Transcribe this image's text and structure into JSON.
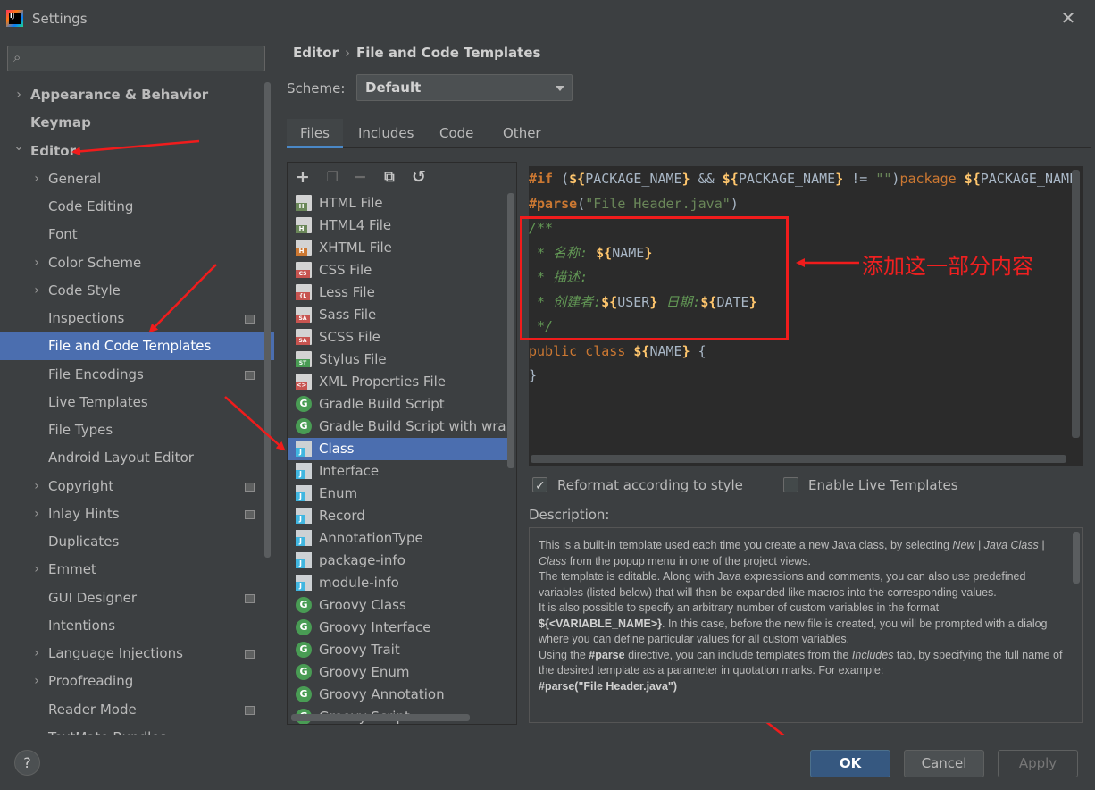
{
  "window": {
    "title": "Settings",
    "close_glyph": "✕"
  },
  "search": {
    "placeholder": ""
  },
  "sidebar": {
    "items": [
      {
        "label": "Appearance & Behavior",
        "expandable": true,
        "bold": true,
        "indent": 0
      },
      {
        "label": "Keymap",
        "expandable": false,
        "bold": true,
        "indent": 0
      },
      {
        "label": "Editor",
        "expandable": true,
        "expanded": true,
        "bold": true,
        "indent": 0
      },
      {
        "label": "General",
        "expandable": true,
        "indent": 1
      },
      {
        "label": "Code Editing",
        "indent": 1
      },
      {
        "label": "Font",
        "indent": 1
      },
      {
        "label": "Color Scheme",
        "expandable": true,
        "indent": 1
      },
      {
        "label": "Code Style",
        "expandable": true,
        "indent": 1
      },
      {
        "label": "Inspections",
        "indent": 1,
        "project_icon": true
      },
      {
        "label": "File and Code Templates",
        "indent": 1,
        "selected": true
      },
      {
        "label": "File Encodings",
        "indent": 1,
        "project_icon": true
      },
      {
        "label": "Live Templates",
        "indent": 1
      },
      {
        "label": "File Types",
        "indent": 1
      },
      {
        "label": "Android Layout Editor",
        "indent": 1
      },
      {
        "label": "Copyright",
        "expandable": true,
        "indent": 1,
        "project_icon": true
      },
      {
        "label": "Inlay Hints",
        "expandable": true,
        "indent": 1,
        "project_icon": true
      },
      {
        "label": "Duplicates",
        "indent": 1
      },
      {
        "label": "Emmet",
        "expandable": true,
        "indent": 1
      },
      {
        "label": "GUI Designer",
        "indent": 1,
        "project_icon": true
      },
      {
        "label": "Intentions",
        "indent": 1
      },
      {
        "label": "Language Injections",
        "expandable": true,
        "indent": 1,
        "project_icon": true
      },
      {
        "label": "Proofreading",
        "expandable": true,
        "indent": 1
      },
      {
        "label": "Reader Mode",
        "indent": 1,
        "project_icon": true
      },
      {
        "label": "TextMate Bundles",
        "indent": 1
      }
    ]
  },
  "breadcrumb": {
    "parent": "Editor",
    "separator": "›",
    "current": "File and Code Templates"
  },
  "scheme": {
    "label": "Scheme:",
    "value": "Default"
  },
  "tabs": [
    {
      "label": "Files",
      "active": true
    },
    {
      "label": "Includes"
    },
    {
      "label": "Code"
    },
    {
      "label": "Other"
    }
  ],
  "toolbar": {
    "add": "+",
    "copy_disabled": "❐",
    "remove": "−",
    "duplicate": "⧉",
    "reset": "↺"
  },
  "templates": [
    {
      "name": "HTML File",
      "icon": "html-file-icon",
      "tag": "H",
      "tag_color": "#6a8759"
    },
    {
      "name": "HTML4 File",
      "icon": "html-file-icon",
      "tag": "H",
      "tag_color": "#6a8759"
    },
    {
      "name": "XHTML File",
      "icon": "xhtml-file-icon",
      "tag": "H",
      "tag_color": "#cc7832"
    },
    {
      "name": "CSS File",
      "icon": "css-file-icon",
      "tag": "CSS",
      "tag_color": "#c75450"
    },
    {
      "name": "Less File",
      "icon": "less-file-icon",
      "tag": "{L}",
      "tag_color": "#c75450"
    },
    {
      "name": "Sass File",
      "icon": "sass-file-icon",
      "tag": "SASS",
      "tag_color": "#c75450"
    },
    {
      "name": "SCSS File",
      "icon": "scss-file-icon",
      "tag": "SASS",
      "tag_color": "#c75450"
    },
    {
      "name": "Stylus File",
      "icon": "stylus-file-icon",
      "tag": "STYL",
      "tag_color": "#499c54"
    },
    {
      "name": "XML Properties File",
      "icon": "xml-file-icon",
      "tag": "<>",
      "tag_color": "#c75450"
    },
    {
      "name": "Gradle Build Script",
      "icon": "gradle-icon",
      "round": "G"
    },
    {
      "name": "Gradle Build Script with wrapper",
      "icon": "gradle-icon",
      "round": "G"
    },
    {
      "name": "Class",
      "icon": "java-class-icon",
      "selected": true
    },
    {
      "name": "Interface",
      "icon": "java-interface-icon"
    },
    {
      "name": "Enum",
      "icon": "java-enum-icon"
    },
    {
      "name": "Record",
      "icon": "java-record-icon"
    },
    {
      "name": "AnnotationType",
      "icon": "java-annotation-icon"
    },
    {
      "name": "package-info",
      "icon": "java-file-icon"
    },
    {
      "name": "module-info",
      "icon": "java-file-icon"
    },
    {
      "name": "Groovy Class",
      "icon": "groovy-icon",
      "round": "G"
    },
    {
      "name": "Groovy Interface",
      "icon": "groovy-icon",
      "round": "G"
    },
    {
      "name": "Groovy Trait",
      "icon": "groovy-icon",
      "round": "G"
    },
    {
      "name": "Groovy Enum",
      "icon": "groovy-icon",
      "round": "G"
    },
    {
      "name": "Groovy Annotation",
      "icon": "groovy-icon",
      "round": "G"
    },
    {
      "name": "Groovy Script",
      "icon": "groovy-icon",
      "round": "G"
    }
  ],
  "code": {
    "line1": [
      {
        "t": "#if",
        "c": "dir"
      },
      {
        "t": " (",
        "c": "plain"
      },
      {
        "t": "${",
        "c": "var"
      },
      {
        "t": "PACKAGE_NAME",
        "c": "varv"
      },
      {
        "t": "}",
        "c": "var"
      },
      {
        "t": " && ",
        "c": "plain"
      },
      {
        "t": "${",
        "c": "var"
      },
      {
        "t": "PACKAGE_NAME",
        "c": "varv"
      },
      {
        "t": "}",
        "c": "var"
      },
      {
        "t": " != ",
        "c": "plain"
      },
      {
        "t": "\"\"",
        "c": "str"
      },
      {
        "t": ")",
        "c": "plain"
      },
      {
        "t": "package ",
        "c": "kw"
      },
      {
        "t": "${",
        "c": "var"
      },
      {
        "t": "PACKAGE_NAME",
        "c": "varv"
      }
    ],
    "line2": [
      {
        "t": "#parse",
        "c": "dir"
      },
      {
        "t": "(",
        "c": "plain"
      },
      {
        "t": "\"File Header.java\"",
        "c": "str"
      },
      {
        "t": ")",
        "c": "plain"
      }
    ],
    "line3": [
      {
        "t": "/**",
        "c": "cmt"
      }
    ],
    "line4": [
      {
        "t": " * 名称: ",
        "c": "cmt"
      },
      {
        "t": "${",
        "c": "var"
      },
      {
        "t": "NAME",
        "c": "varv"
      },
      {
        "t": "}",
        "c": "var"
      }
    ],
    "line5": [
      {
        "t": " * 描述:",
        "c": "cmt"
      }
    ],
    "line6": [
      {
        "t": " * 创建者:",
        "c": "cmt"
      },
      {
        "t": "${",
        "c": "var"
      },
      {
        "t": "USER",
        "c": "varv"
      },
      {
        "t": "}",
        "c": "var"
      },
      {
        "t": " 日期:",
        "c": "cmt"
      },
      {
        "t": "${",
        "c": "var"
      },
      {
        "t": "DATE",
        "c": "varv"
      },
      {
        "t": "}",
        "c": "var"
      }
    ],
    "line7": [
      {
        "t": " */",
        "c": "cmt"
      }
    ],
    "line8": [
      {
        "t": "public class ",
        "c": "kw"
      },
      {
        "t": "${",
        "c": "var"
      },
      {
        "t": "NAME",
        "c": "varv"
      },
      {
        "t": "}",
        "c": "var"
      },
      {
        "t": " {",
        "c": "plain"
      }
    ],
    "line9": [
      {
        "t": "}",
        "c": "plain"
      }
    ]
  },
  "annotation": {
    "text": "添加这一部分内容",
    "color": "#f02020"
  },
  "options": {
    "reformat": {
      "label": "Reformat according to style",
      "checked": true
    },
    "live": {
      "label": "Enable Live Templates",
      "checked": false
    }
  },
  "description": {
    "label": "Description:",
    "p1a": "This is a built-in template used each time you create a new Java class, by selecting ",
    "p1b": "New | Java Class | Class",
    "p1c": " from the popup menu in one of the project views.",
    "p2": "The template is editable. Along with Java expressions and comments, you can also use predefined variables (listed below) that will then be expanded like macros into the corresponding values.",
    "p3a": "It is also possible to specify an arbitrary number of custom variables in the format ",
    "p3b": "${<VARIABLE_NAME>}",
    "p3c": ". In this case, before the new file is created, you will be prompted with a dialog where you can define particular values for all custom variables.",
    "p4a": "Using the ",
    "p4b": "#parse",
    "p4c": " directive, you can include templates from the ",
    "p4d": "Includes",
    "p4e": " tab, by specifying the full name of the desired template as a parameter in quotation marks. For example:",
    "p5": "#parse(\"File Header.java\")"
  },
  "buttons": {
    "help": "?",
    "ok": "OK",
    "cancel": "Cancel",
    "apply": "Apply"
  },
  "colors": {
    "selection": "#4b6eaf",
    "primary_button": "#365880",
    "annotation_red": "#f01c1c"
  }
}
